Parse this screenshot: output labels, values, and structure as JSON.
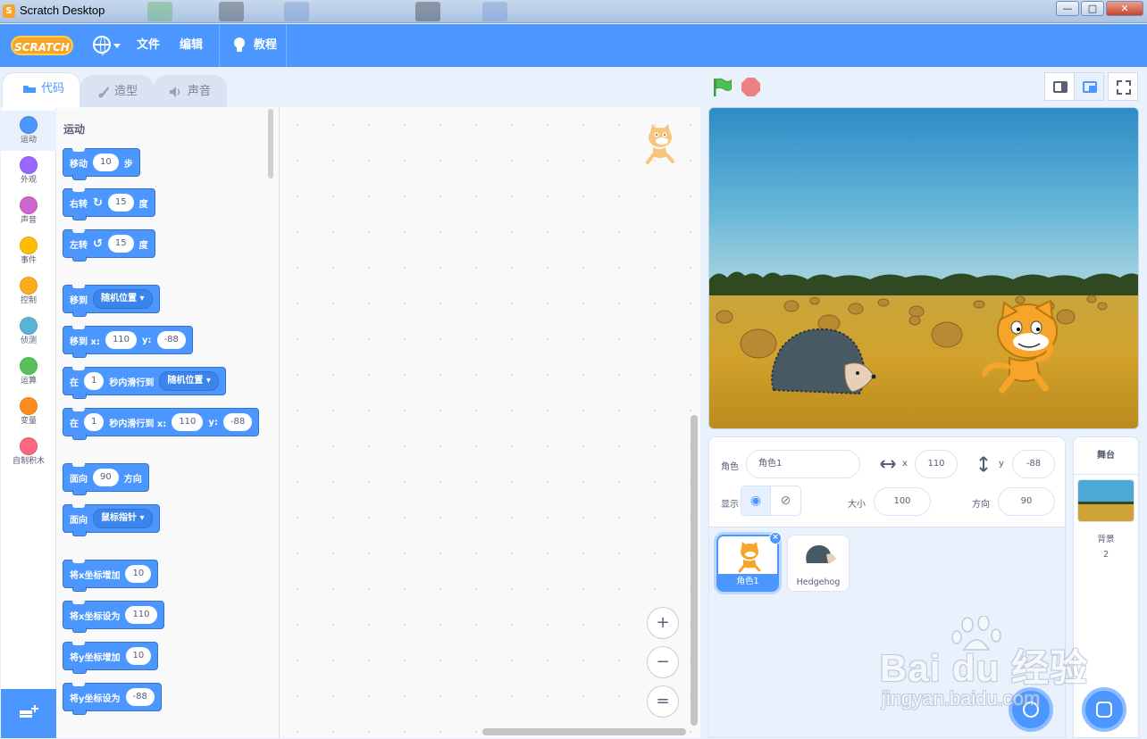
{
  "window": {
    "title": "Scratch Desktop",
    "app_icon_letter": "S",
    "minimize": "—",
    "maximize": "□",
    "close": "✕"
  },
  "menubar": {
    "logo": "SCRATCH",
    "file": "文件",
    "edit": "编辑",
    "tutorials": "教程",
    "language_icon": "globe-icon"
  },
  "tabs": [
    {
      "label": "代码",
      "icon": "code-icon",
      "active": true
    },
    {
      "label": "造型",
      "icon": "brush-icon",
      "active": false
    },
    {
      "label": "声音",
      "icon": "speaker-icon",
      "active": false
    }
  ],
  "categories": [
    {
      "label": "运动",
      "color": "#4c97ff",
      "active": true
    },
    {
      "label": "外观",
      "color": "#9966ff",
      "active": false
    },
    {
      "label": "声音",
      "color": "#cf63cf",
      "active": false
    },
    {
      "label": "事件",
      "color": "#ffbf00",
      "active": false
    },
    {
      "label": "控制",
      "color": "#ffab19",
      "active": false
    },
    {
      "label": "侦测",
      "color": "#5cb1d6",
      "active": false
    },
    {
      "label": "运算",
      "color": "#59c059",
      "active": false
    },
    {
      "label": "变量",
      "color": "#ff8c1a",
      "active": false
    },
    {
      "label": "自制积木",
      "color": "#ff6680",
      "active": false
    }
  ],
  "palette": {
    "section_title": "运动",
    "blocks": {
      "move": {
        "pre": "移动",
        "value": "10",
        "post": "步"
      },
      "turn_right": {
        "pre": "右转",
        "icon": "↻",
        "value": "15",
        "post": "度"
      },
      "turn_left": {
        "pre": "左转",
        "icon": "↺",
        "value": "15",
        "post": "度"
      },
      "goto": {
        "pre": "移到",
        "dropdown": "随机位置"
      },
      "goto_xy": {
        "pre": "移到 x:",
        "x": "110",
        "mid": "y:",
        "y": "-88"
      },
      "glide": {
        "pre": "在",
        "secs": "1",
        "mid": "秒内滑行到",
        "dropdown": "随机位置"
      },
      "glide_xy": {
        "pre": "在",
        "secs": "1",
        "mid": "秒内滑行到 x:",
        "x": "110",
        "mid2": "y:",
        "y": "-88"
      },
      "point_dir": {
        "pre": "面向",
        "value": "90",
        "post": "方向"
      },
      "point_towards": {
        "pre": "面向",
        "dropdown": "鼠标指针"
      },
      "change_x": {
        "pre": "将x坐标增加",
        "value": "10"
      },
      "set_x": {
        "pre": "将x坐标设为",
        "value": "110"
      },
      "change_y": {
        "pre": "将y坐标增加",
        "value": "10"
      },
      "set_y": {
        "pre": "将y坐标设为",
        "value": "-88"
      }
    }
  },
  "script_area": {
    "zoom_in": "+",
    "zoom_out": "−",
    "zoom_reset": "="
  },
  "stage_header": {
    "green_flag": "green-flag-icon",
    "stop": "stop-icon"
  },
  "sprite_info": {
    "sprite_label": "角色",
    "sprite_name": "角色1",
    "x_label": "x",
    "x": "110",
    "y_label": "y",
    "y": "-88",
    "show_label": "显示",
    "size_label": "大小",
    "size": "100",
    "direction_label": "方向",
    "direction": "90"
  },
  "sprites": [
    {
      "name": "角色1",
      "selected": true
    },
    {
      "name": "Hedgehog",
      "selected": false
    }
  ],
  "stage_panel": {
    "title": "舞台",
    "backdrop_label": "背景",
    "backdrop_count": "2"
  },
  "watermark": {
    "brand": "Bai du 经验",
    "url": "jingyan.baidu.com"
  }
}
